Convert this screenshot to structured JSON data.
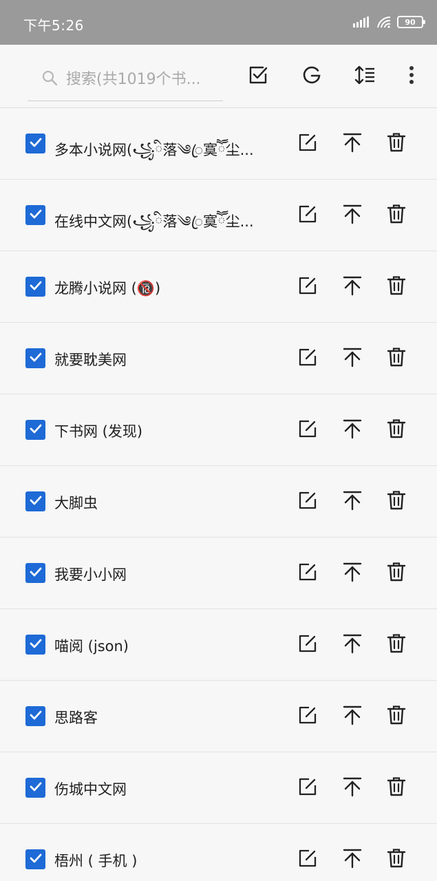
{
  "status_bar": {
    "time": "下午5:26",
    "battery": "90",
    "icons": [
      "signal-icon",
      "wifi-icon",
      "battery-icon"
    ]
  },
  "toolbar": {
    "search_placeholder": "搜索(共1019个书...",
    "actions": [
      "select-all-icon",
      "g-icon",
      "sort-icon",
      "more-vert-icon"
    ]
  },
  "colors": {
    "status_bar_bg": "#9a9a9a",
    "checkbox_blue": "#1e6ad6",
    "background": "#f6f6f6"
  },
  "sources": [
    {
      "name": "多本小说网(꧁ི落༄ꦿ寞ཽ尘...",
      "checked": true
    },
    {
      "name": "在线中文网(꧁ི落༄ꦿ寞ཽ尘...",
      "checked": true
    },
    {
      "name": "龙腾小说网 (🔞)",
      "checked": true
    },
    {
      "name": "就要耽美网",
      "checked": true
    },
    {
      "name": "下书网 (发现)",
      "checked": true
    },
    {
      "name": "大脚虫",
      "checked": true
    },
    {
      "name": "我要小小网",
      "checked": true
    },
    {
      "name": "喵阅 (json)",
      "checked": true
    },
    {
      "name": "思路客",
      "checked": true
    },
    {
      "name": "伤城中文网",
      "checked": true
    },
    {
      "name": "梧州 ( 手机 )",
      "checked": true
    }
  ],
  "row_actions": [
    "edit-icon",
    "move-to-top-icon",
    "delete-icon"
  ]
}
